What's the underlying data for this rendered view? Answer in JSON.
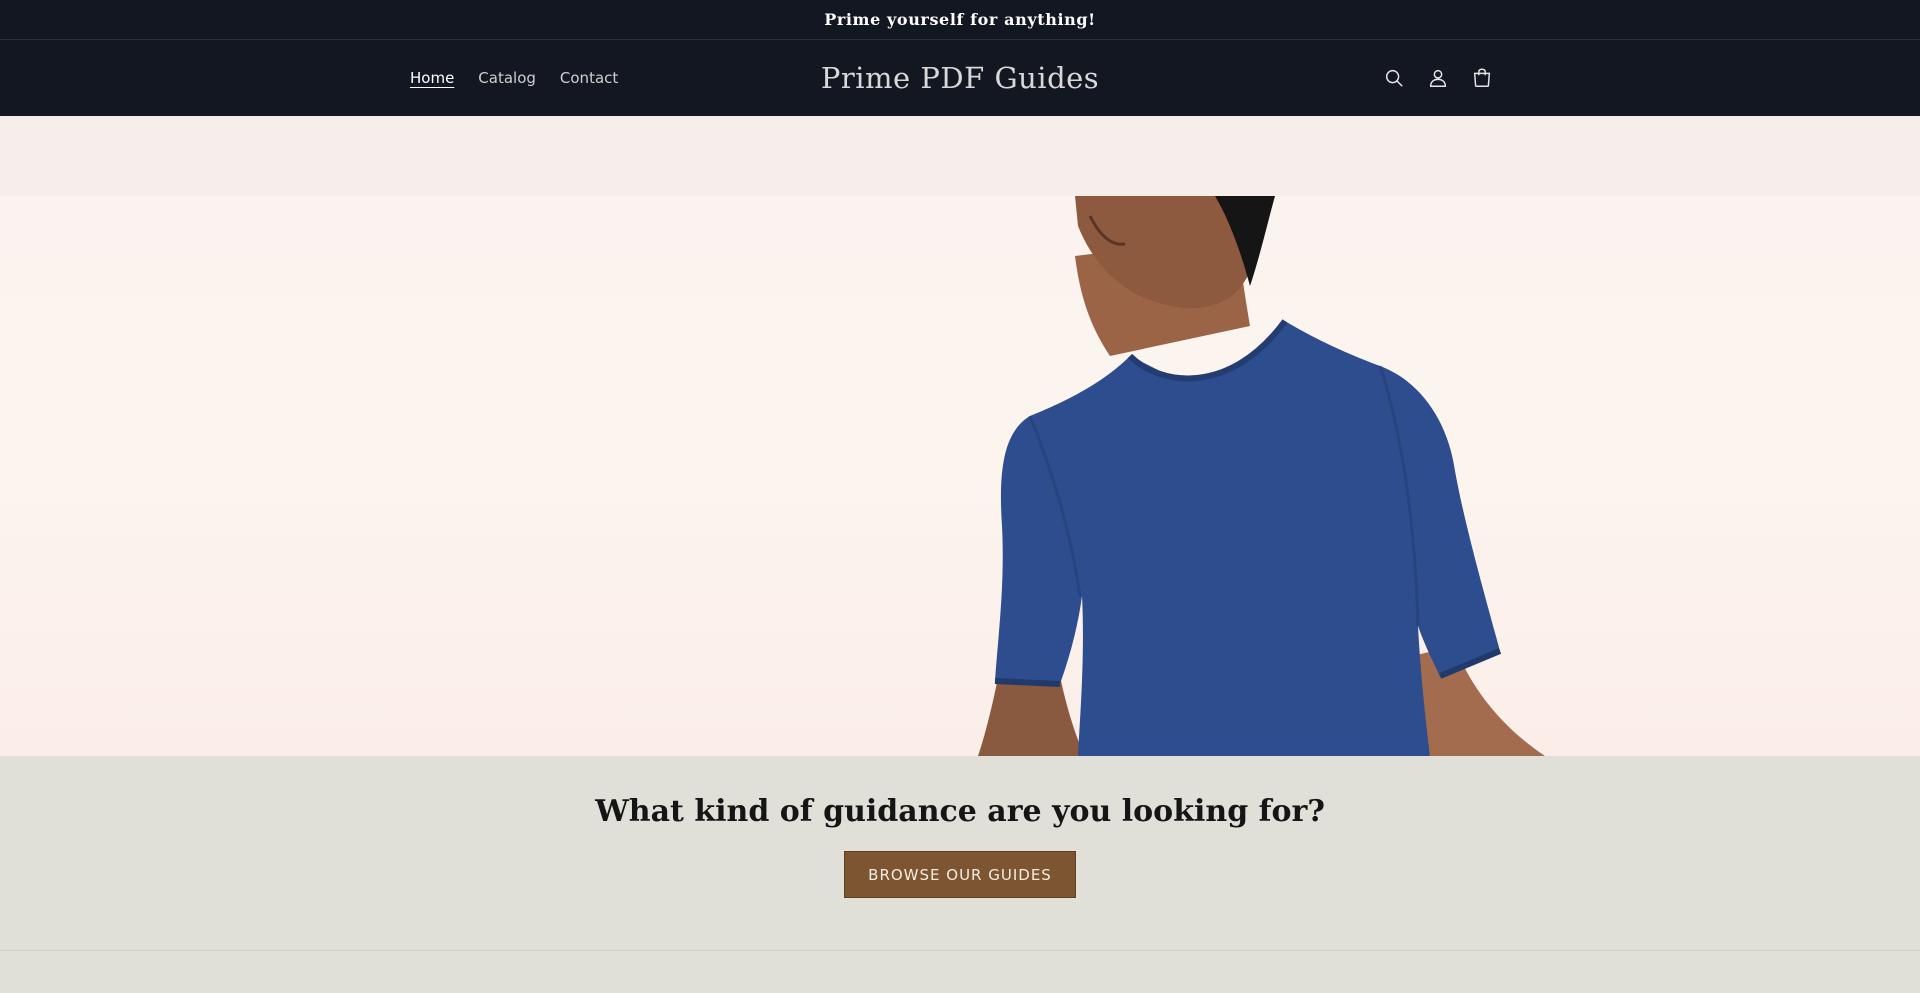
{
  "announcement": {
    "text": "Prime yourself for anything!"
  },
  "header": {
    "nav": [
      {
        "label": "Home",
        "active": true
      },
      {
        "label": "Catalog",
        "active": false
      },
      {
        "label": "Contact",
        "active": false
      }
    ],
    "logo": "Prime PDF Guides",
    "icons": [
      "search-icon",
      "account-icon",
      "cart-icon"
    ]
  },
  "hero": {
    "image": "man-in-blue-tshirt"
  },
  "cta": {
    "heading": "What kind of guidance are you looking for?",
    "button_label": "BROWSE OUR GUIDES"
  },
  "colors": {
    "header_bg": "#131722",
    "button_bg": "#7d5530",
    "section_bg": "#e0dfd8",
    "shirt": "#2d4d8e"
  }
}
